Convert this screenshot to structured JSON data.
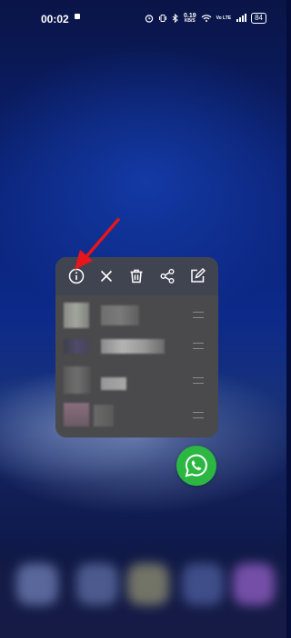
{
  "status_bar": {
    "time": "00:02",
    "network_speed": "0.19",
    "network_speed_unit": "KB/S",
    "network_type": "Vo LTE",
    "battery": "84"
  },
  "toolbar": {
    "icons": [
      "info-icon",
      "close-icon",
      "trash-icon",
      "share-icon",
      "edit-icon"
    ]
  },
  "shortcuts_count_visible": 4,
  "colors": {
    "card": "#4a4a4c",
    "toolbar": "#3f4450",
    "whatsapp": "#2bb741",
    "arrow": "#e8151b"
  }
}
